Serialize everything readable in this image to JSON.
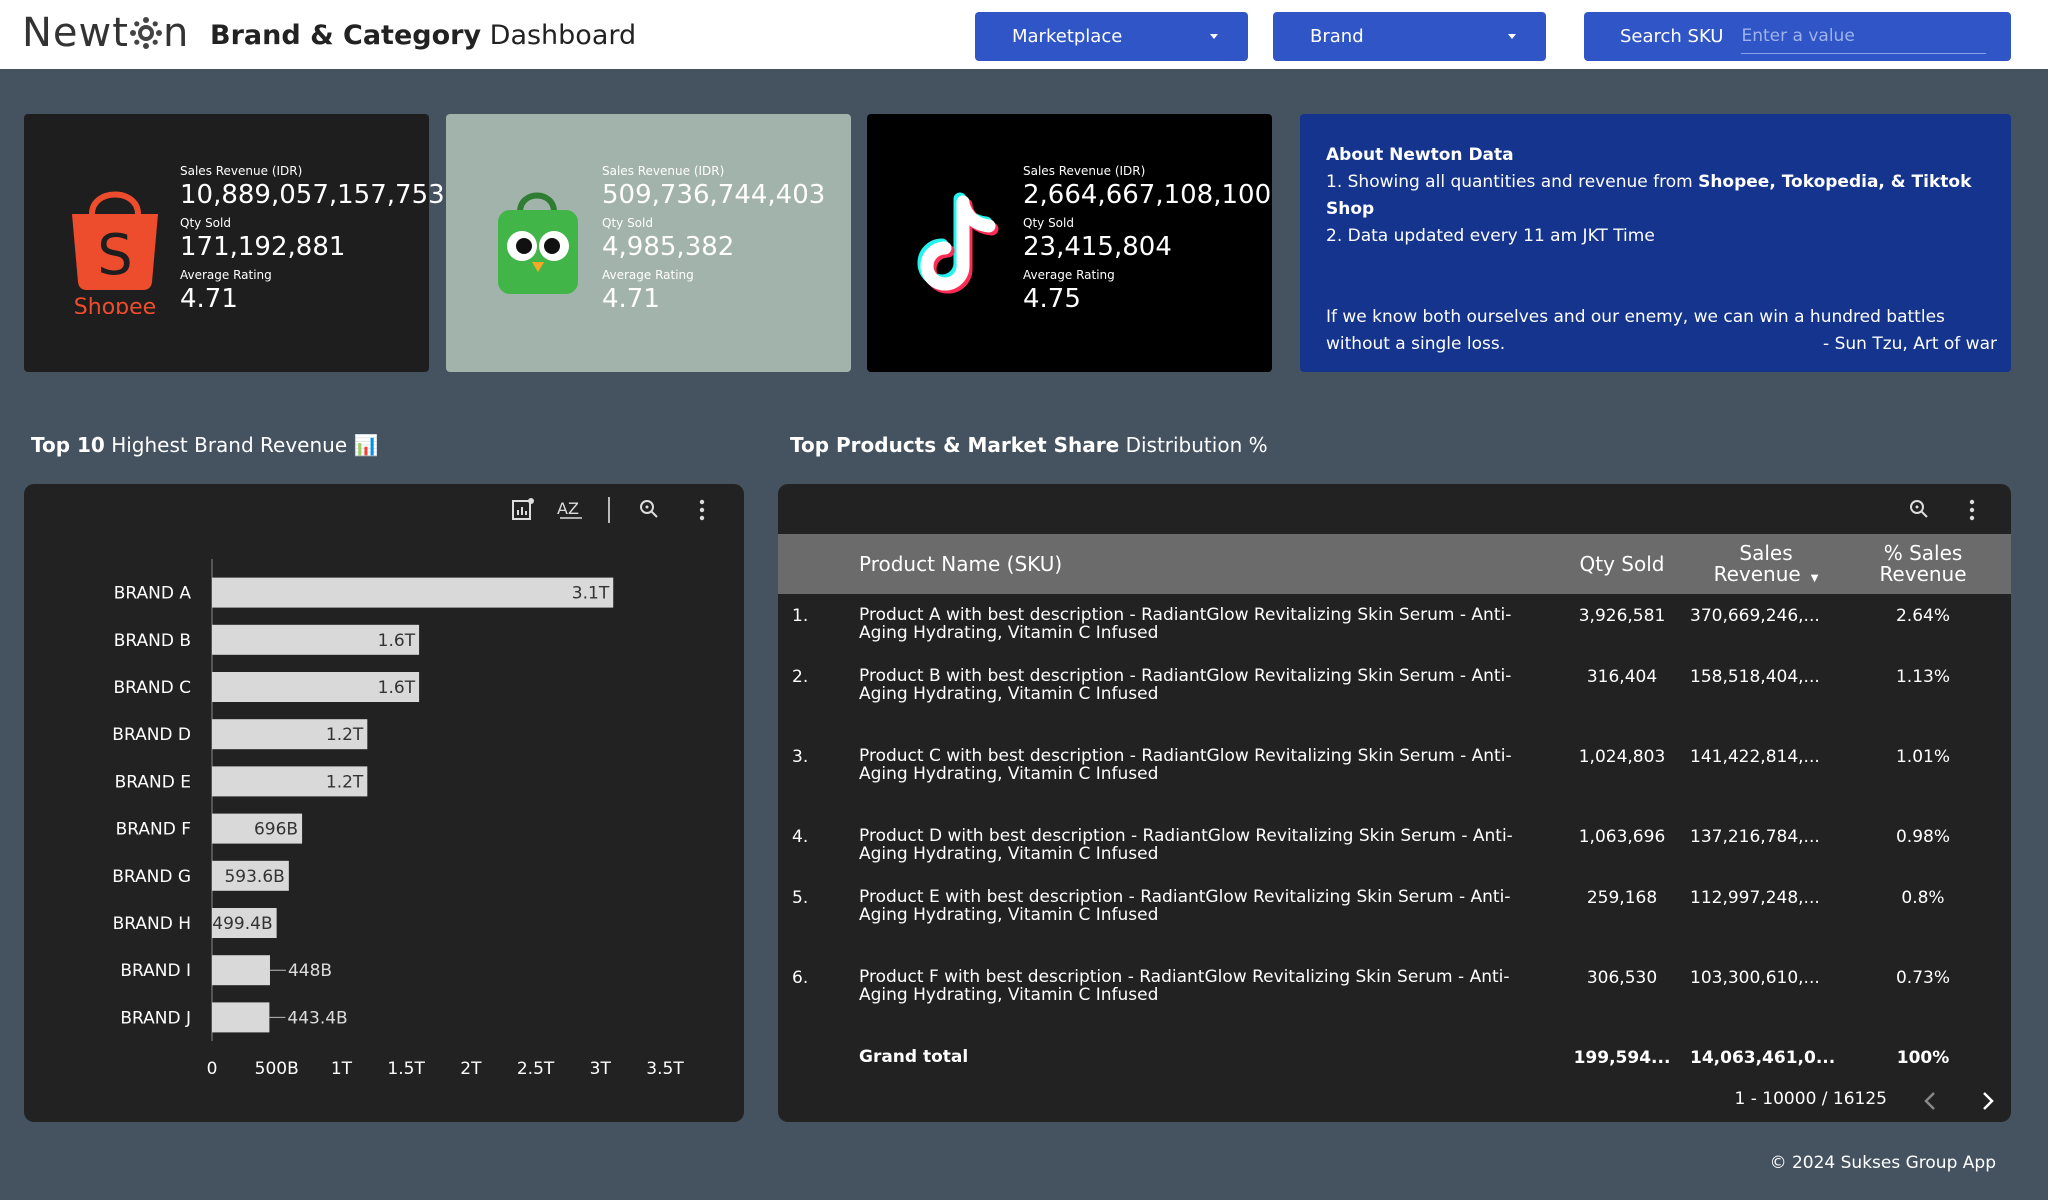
{
  "header": {
    "logo_text_left": "Newt",
    "logo_text_right": "n",
    "title_bold": "Brand & Category",
    "title_rest": "Dashboard",
    "marketplace_label": "Marketplace",
    "brand_label": "Brand",
    "search_label": "Search SKU",
    "search_placeholder": "Enter a value"
  },
  "cards": [
    {
      "platform": "Shopee",
      "rev_label": "Sales Revenue (IDR)",
      "rev": "10,889,057,157,753",
      "qty_label": "Qty Sold",
      "qty": "171,192,881",
      "rating_label": "Average Rating",
      "rating": "4.71"
    },
    {
      "platform": "Tokopedia",
      "rev_label": "Sales Revenue (IDR)",
      "rev": "509,736,744,403",
      "qty_label": "Qty Sold",
      "qty": "4,985,382",
      "rating_label": "Average Rating",
      "rating": "4.71"
    },
    {
      "platform": "TikTok",
      "rev_label": "Sales Revenue (IDR)",
      "rev": "2,664,667,108,100",
      "qty_label": "Qty Sold",
      "qty": "23,415,804",
      "rating_label": "Average Rating",
      "rating": "4.75"
    }
  ],
  "about": {
    "title": "About Newton Data",
    "line1_prefix": "1. Showing all quantities and revenue from ",
    "line1_bold": "Shopee, Tokopedia, & Tiktok Shop",
    "line2": "2. Data updated every 11 am JKT Time",
    "quote": "If we know both ourselves and our enemy, we can win a hundred battles without a single loss.",
    "author": "- Sun Tzu, Art of war"
  },
  "sections": {
    "brand_title_bold": "Top 10",
    "brand_title_rest": "Highest Brand Revenue 📊",
    "products_title_bold": "Top Products & Market Share",
    "products_title_rest": "Distribution %"
  },
  "chart_data": {
    "type": "bar",
    "orientation": "horizontal",
    "categories": [
      "BRAND A",
      "BRAND B",
      "BRAND C",
      "BRAND D",
      "BRAND E",
      "BRAND F",
      "BRAND G",
      "BRAND H",
      "BRAND I",
      "BRAND J"
    ],
    "values": [
      3100000000000.0,
      1600000000000.0,
      1600000000000.0,
      1200000000000.0,
      1200000000000.0,
      696000000000.0,
      593600000000.0,
      499400000000.0,
      448000000000.0,
      443400000000.0
    ],
    "labels": [
      "3.1T",
      "1.6T",
      "1.6T",
      "1.2T",
      "1.2T",
      "696B",
      "593.6B",
      "499.4B",
      "448B",
      "443.4B"
    ],
    "xlim": [
      0,
      3500000000000.0
    ],
    "xticks": [
      0,
      500000000000.0,
      1000000000000.0,
      1500000000000.0,
      2000000000000.0,
      2500000000000.0,
      3000000000000.0,
      3500000000000.0
    ],
    "xtick_labels": [
      "0",
      "500B",
      "1T",
      "1.5T",
      "2T",
      "2.5T",
      "3T",
      "3.5T"
    ],
    "bar_color": "#d9d9d9",
    "grid": false
  },
  "table": {
    "headers": {
      "product": "Product Name (SKU)",
      "qty": "Qty Sold",
      "rev_line1": "Sales",
      "rev_line2": "Revenue",
      "pct_line1": "% Sales",
      "pct_line2": "Revenue"
    },
    "rows": [
      {
        "n": "1.",
        "name": "Product A with best description - RadiantGlow Revitalizing Skin Serum - Anti-Aging Hydrating, Vitamin C Infused",
        "qty": "3,926,581",
        "rev": "370,669,246,...",
        "pct": "2.64%"
      },
      {
        "n": "2.",
        "name": "Product B with best description - RadiantGlow Revitalizing Skin Serum - Anti-Aging Hydrating, Vitamin C Infused",
        "qty": "316,404",
        "rev": "158,518,404,...",
        "pct": "1.13%"
      },
      {
        "n": "3.",
        "name": "Product C with best description - RadiantGlow Revitalizing Skin Serum - Anti-Aging Hydrating, Vitamin C Infused",
        "qty": "1,024,803",
        "rev": "141,422,814,...",
        "pct": "1.01%"
      },
      {
        "n": "4.",
        "name": "Product D with best description - RadiantGlow Revitalizing Skin Serum - Anti-Aging Hydrating, Vitamin C Infused",
        "qty": "1,063,696",
        "rev": "137,216,784,...",
        "pct": "0.98%"
      },
      {
        "n": "5.",
        "name": "Product E with best description - RadiantGlow Revitalizing Skin Serum - Anti-Aging Hydrating, Vitamin C Infused",
        "qty": "259,168",
        "rev": "112,997,248,...",
        "pct": "0.8%"
      },
      {
        "n": "6.",
        "name": "Product F with best description - RadiantGlow Revitalizing Skin Serum - Anti-Aging Hydrating, Vitamin C Infused",
        "qty": "306,530",
        "rev": "103,300,610,...",
        "pct": "0.73%"
      }
    ],
    "grand_total": {
      "label": "Grand total",
      "qty": "199,594...",
      "rev": "14,063,461,0...",
      "pct": "100%"
    },
    "pager": "1 - 10000 / 16125"
  },
  "footer": "© 2024 Sukses Group App",
  "colors": {
    "background": "#455360",
    "panel": "#222222",
    "header_control": "#2f55c6",
    "about_bg": "#14348e",
    "shopee": "#ee4d2d",
    "tokopedia_card": "#a2b3ab",
    "tokopedia_green": "#42b549"
  }
}
